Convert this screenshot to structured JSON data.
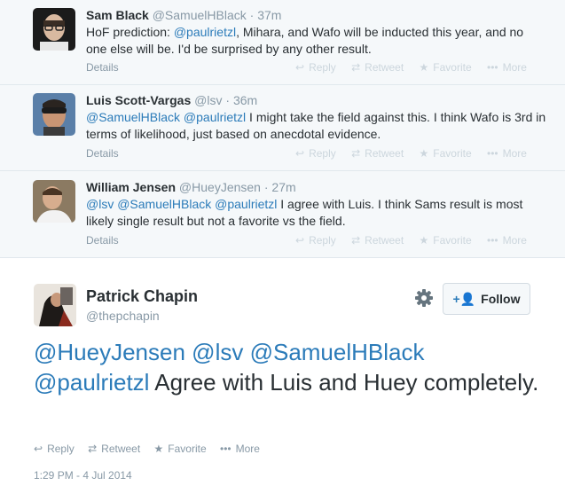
{
  "replies": [
    {
      "fullname": "Sam Black",
      "handle": "@SamuelHBlack",
      "separator": "·",
      "time": "37m",
      "text_segments": [
        {
          "text": "HoF prediction: ",
          "mention": false
        },
        {
          "text": "@paulrietzl",
          "mention": true
        },
        {
          "text": ", Mihara, and Wafo will be inducted this year, and no one else will be. I'd be surprised by any other result.",
          "mention": false
        }
      ],
      "details_label": "Details",
      "actions": {
        "reply": "Reply",
        "retweet": "Retweet",
        "favorite": "Favorite",
        "more": "More"
      }
    },
    {
      "fullname": "Luis Scott-Vargas",
      "handle": "@lsv",
      "separator": "·",
      "time": "36m",
      "text_segments": [
        {
          "text": "@SamuelHBlack",
          "mention": true
        },
        {
          "text": " ",
          "mention": false
        },
        {
          "text": "@paulrietzl",
          "mention": true
        },
        {
          "text": " I might take the field against this. I think Wafo is 3rd in terms of likelihood, just based on anecdotal evidence.",
          "mention": false
        }
      ],
      "details_label": "Details",
      "actions": {
        "reply": "Reply",
        "retweet": "Retweet",
        "favorite": "Favorite",
        "more": "More"
      }
    },
    {
      "fullname": "William Jensen",
      "handle": "@HueyJensen",
      "separator": "·",
      "time": "27m",
      "text_segments": [
        {
          "text": "@lsv",
          "mention": true
        },
        {
          "text": " ",
          "mention": false
        },
        {
          "text": "@SamuelHBlack",
          "mention": true
        },
        {
          "text": " ",
          "mention": false
        },
        {
          "text": "@paulrietzl",
          "mention": true
        },
        {
          "text": " I agree with Luis. I think Sams result is most likely single result but not a favorite vs the field.",
          "mention": false
        }
      ],
      "details_label": "Details",
      "actions": {
        "reply": "Reply",
        "retweet": "Retweet",
        "favorite": "Favorite",
        "more": "More"
      }
    }
  ],
  "main": {
    "fullname": "Patrick Chapin",
    "handle": "@thepchapin",
    "follow_label": "Follow",
    "text_segments": [
      {
        "text": "@HueyJensen",
        "mention": true
      },
      {
        "text": " ",
        "mention": false
      },
      {
        "text": "@lsv",
        "mention": true
      },
      {
        "text": " ",
        "mention": false
      },
      {
        "text": "@SamuelHBlack",
        "mention": true
      },
      {
        "text": " ",
        "mention": false
      },
      {
        "text": "@paulrietzl",
        "mention": true
      },
      {
        "text": " Agree with Luis and Huey completely.",
        "mention": false
      }
    ],
    "actions": {
      "reply": "Reply",
      "retweet": "Retweet",
      "favorite": "Favorite",
      "more": "More"
    },
    "timestamp": "1:29 PM - 4 Jul 2014"
  },
  "colors": {
    "link": "#2b7bb9",
    "muted": "#8899a6",
    "reply_bg": "#f5f8fa"
  }
}
